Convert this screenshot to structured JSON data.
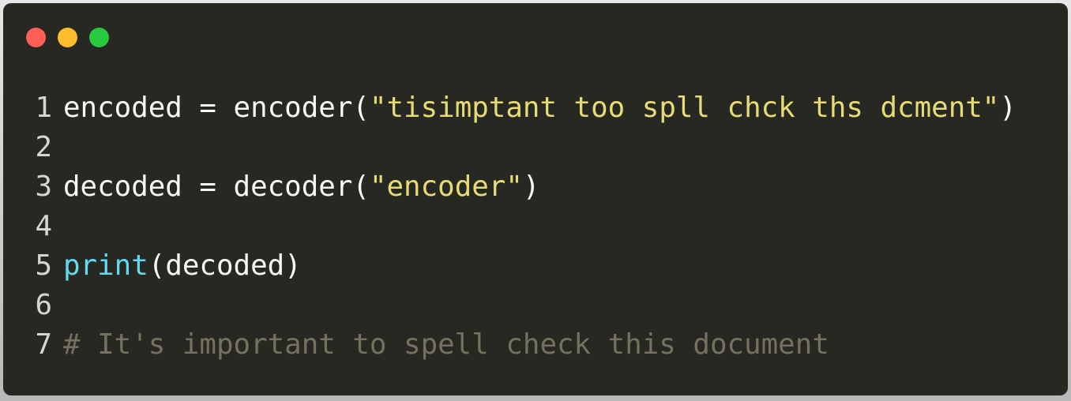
{
  "window": {
    "controls": [
      {
        "name": "close",
        "color": "#ff5f56"
      },
      {
        "name": "minimize",
        "color": "#ffbd2e"
      },
      {
        "name": "maximize",
        "color": "#27c93f"
      }
    ]
  },
  "colors": {
    "text": "#f8f8f2",
    "string": "#e6db74",
    "builtin": "#66d9ef",
    "comment": "#75715e"
  },
  "lines": [
    {
      "number": "1",
      "tokens": [
        {
          "t": "encoded = encoder(",
          "c": "text"
        },
        {
          "t": "\"tisimptant too spll chck ths dcment\"",
          "c": "string"
        },
        {
          "t": ")",
          "c": "text"
        }
      ]
    },
    {
      "number": "2",
      "tokens": []
    },
    {
      "number": "3",
      "tokens": [
        {
          "t": "decoded = decoder(",
          "c": "text"
        },
        {
          "t": "\"encoder\"",
          "c": "string"
        },
        {
          "t": ")",
          "c": "text"
        }
      ]
    },
    {
      "number": "4",
      "tokens": []
    },
    {
      "number": "5",
      "tokens": [
        {
          "t": "print",
          "c": "builtin"
        },
        {
          "t": "(decoded)",
          "c": "text"
        }
      ]
    },
    {
      "number": "6",
      "tokens": []
    },
    {
      "number": "7",
      "tokens": [
        {
          "t": "# It's important to spell check this document",
          "c": "comment"
        }
      ]
    }
  ]
}
